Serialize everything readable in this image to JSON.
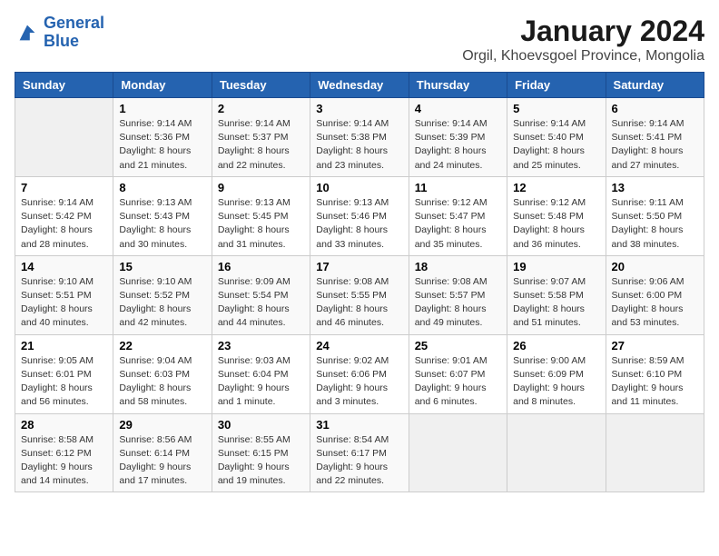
{
  "logo": {
    "line1": "General",
    "line2": "Blue"
  },
  "title": "January 2024",
  "subtitle": "Orgil, Khoevsgoel Province, Mongolia",
  "days_of_week": [
    "Sunday",
    "Monday",
    "Tuesday",
    "Wednesday",
    "Thursday",
    "Friday",
    "Saturday"
  ],
  "weeks": [
    [
      {
        "day": "",
        "info": ""
      },
      {
        "day": "1",
        "info": "Sunrise: 9:14 AM\nSunset: 5:36 PM\nDaylight: 8 hours\nand 21 minutes."
      },
      {
        "day": "2",
        "info": "Sunrise: 9:14 AM\nSunset: 5:37 PM\nDaylight: 8 hours\nand 22 minutes."
      },
      {
        "day": "3",
        "info": "Sunrise: 9:14 AM\nSunset: 5:38 PM\nDaylight: 8 hours\nand 23 minutes."
      },
      {
        "day": "4",
        "info": "Sunrise: 9:14 AM\nSunset: 5:39 PM\nDaylight: 8 hours\nand 24 minutes."
      },
      {
        "day": "5",
        "info": "Sunrise: 9:14 AM\nSunset: 5:40 PM\nDaylight: 8 hours\nand 25 minutes."
      },
      {
        "day": "6",
        "info": "Sunrise: 9:14 AM\nSunset: 5:41 PM\nDaylight: 8 hours\nand 27 minutes."
      }
    ],
    [
      {
        "day": "7",
        "info": "Sunrise: 9:14 AM\nSunset: 5:42 PM\nDaylight: 8 hours\nand 28 minutes."
      },
      {
        "day": "8",
        "info": "Sunrise: 9:13 AM\nSunset: 5:43 PM\nDaylight: 8 hours\nand 30 minutes."
      },
      {
        "day": "9",
        "info": "Sunrise: 9:13 AM\nSunset: 5:45 PM\nDaylight: 8 hours\nand 31 minutes."
      },
      {
        "day": "10",
        "info": "Sunrise: 9:13 AM\nSunset: 5:46 PM\nDaylight: 8 hours\nand 33 minutes."
      },
      {
        "day": "11",
        "info": "Sunrise: 9:12 AM\nSunset: 5:47 PM\nDaylight: 8 hours\nand 35 minutes."
      },
      {
        "day": "12",
        "info": "Sunrise: 9:12 AM\nSunset: 5:48 PM\nDaylight: 8 hours\nand 36 minutes."
      },
      {
        "day": "13",
        "info": "Sunrise: 9:11 AM\nSunset: 5:50 PM\nDaylight: 8 hours\nand 38 minutes."
      }
    ],
    [
      {
        "day": "14",
        "info": "Sunrise: 9:10 AM\nSunset: 5:51 PM\nDaylight: 8 hours\nand 40 minutes."
      },
      {
        "day": "15",
        "info": "Sunrise: 9:10 AM\nSunset: 5:52 PM\nDaylight: 8 hours\nand 42 minutes."
      },
      {
        "day": "16",
        "info": "Sunrise: 9:09 AM\nSunset: 5:54 PM\nDaylight: 8 hours\nand 44 minutes."
      },
      {
        "day": "17",
        "info": "Sunrise: 9:08 AM\nSunset: 5:55 PM\nDaylight: 8 hours\nand 46 minutes."
      },
      {
        "day": "18",
        "info": "Sunrise: 9:08 AM\nSunset: 5:57 PM\nDaylight: 8 hours\nand 49 minutes."
      },
      {
        "day": "19",
        "info": "Sunrise: 9:07 AM\nSunset: 5:58 PM\nDaylight: 8 hours\nand 51 minutes."
      },
      {
        "day": "20",
        "info": "Sunrise: 9:06 AM\nSunset: 6:00 PM\nDaylight: 8 hours\nand 53 minutes."
      }
    ],
    [
      {
        "day": "21",
        "info": "Sunrise: 9:05 AM\nSunset: 6:01 PM\nDaylight: 8 hours\nand 56 minutes."
      },
      {
        "day": "22",
        "info": "Sunrise: 9:04 AM\nSunset: 6:03 PM\nDaylight: 8 hours\nand 58 minutes."
      },
      {
        "day": "23",
        "info": "Sunrise: 9:03 AM\nSunset: 6:04 PM\nDaylight: 9 hours\nand 1 minute."
      },
      {
        "day": "24",
        "info": "Sunrise: 9:02 AM\nSunset: 6:06 PM\nDaylight: 9 hours\nand 3 minutes."
      },
      {
        "day": "25",
        "info": "Sunrise: 9:01 AM\nSunset: 6:07 PM\nDaylight: 9 hours\nand 6 minutes."
      },
      {
        "day": "26",
        "info": "Sunrise: 9:00 AM\nSunset: 6:09 PM\nDaylight: 9 hours\nand 8 minutes."
      },
      {
        "day": "27",
        "info": "Sunrise: 8:59 AM\nSunset: 6:10 PM\nDaylight: 9 hours\nand 11 minutes."
      }
    ],
    [
      {
        "day": "28",
        "info": "Sunrise: 8:58 AM\nSunset: 6:12 PM\nDaylight: 9 hours\nand 14 minutes."
      },
      {
        "day": "29",
        "info": "Sunrise: 8:56 AM\nSunset: 6:14 PM\nDaylight: 9 hours\nand 17 minutes."
      },
      {
        "day": "30",
        "info": "Sunrise: 8:55 AM\nSunset: 6:15 PM\nDaylight: 9 hours\nand 19 minutes."
      },
      {
        "day": "31",
        "info": "Sunrise: 8:54 AM\nSunset: 6:17 PM\nDaylight: 9 hours\nand 22 minutes."
      },
      {
        "day": "",
        "info": ""
      },
      {
        "day": "",
        "info": ""
      },
      {
        "day": "",
        "info": ""
      }
    ]
  ]
}
